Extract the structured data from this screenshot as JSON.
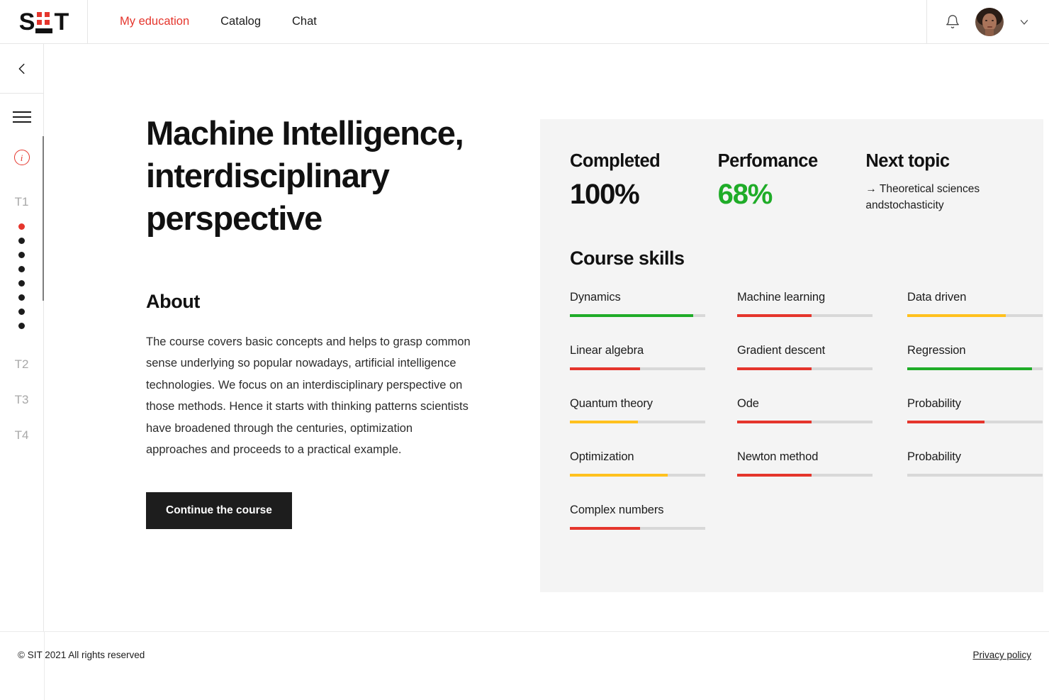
{
  "brand": {
    "logo_s": "S",
    "logo_t": "T",
    "logo_alt": "SIT"
  },
  "nav": {
    "links": [
      {
        "label": "My education",
        "active": true
      },
      {
        "label": "Catalog",
        "active": false
      },
      {
        "label": "Chat",
        "active": false
      }
    ],
    "bell_icon": "bell-icon",
    "avatar_icon": "user-avatar",
    "chevron_icon": "chevron-down-icon"
  },
  "sidebar": {
    "back_icon": "chevron-left-icon",
    "menu_icon": "hamburger-menu-icon",
    "info_icon": "info-icon",
    "info_glyph": "i",
    "topic_labels": [
      "T1",
      "T2",
      "T3",
      "T4"
    ],
    "lesson_dots": [
      {
        "current": true
      },
      {
        "current": false
      },
      {
        "current": false
      },
      {
        "current": false
      },
      {
        "current": false
      },
      {
        "current": false
      },
      {
        "current": false
      },
      {
        "current": false
      }
    ]
  },
  "course": {
    "title": "Machine Intelligence, interdisciplinary perspective",
    "about_heading": "About",
    "about_text": "The course covers basic concepts and helps to grasp common sense underlying so popular nowadays, artificial intelligence technologies. We focus on an interdisciplinary perspective on those methods. Hence it starts with thinking patterns scientists have broadened through the centuries, optimization approaches and proceeds to a practical example.",
    "cta_label": "Continue the course"
  },
  "stats": [
    {
      "label": "Completed",
      "value": "100%",
      "color": "#111111"
    },
    {
      "label": "Perfomance",
      "value": "68%",
      "color": "#1fac28"
    }
  ],
  "next_topic": {
    "label": "Next topic",
    "arrow": "→",
    "text": "Theoretical sciences andstochasticity"
  },
  "skills_section": {
    "heading": "Course skills"
  },
  "skills": [
    {
      "name": "Dynamics",
      "percent": 91,
      "color": "#1fac28"
    },
    {
      "name": "Machine learning",
      "percent": 55,
      "color": "#e5352c"
    },
    {
      "name": "Data driven",
      "percent": 73,
      "color": "#ffc11e"
    },
    {
      "name": "Linear algebra",
      "percent": 52,
      "color": "#e5352c"
    },
    {
      "name": "Gradient descent",
      "percent": 55,
      "color": "#e5352c"
    },
    {
      "name": "Regression",
      "percent": 92,
      "color": "#1fac28"
    },
    {
      "name": "Quantum theory",
      "percent": 50,
      "color": "#ffc11e"
    },
    {
      "name": "Ode",
      "percent": 55,
      "color": "#e5352c"
    },
    {
      "name": "Probability",
      "percent": 57,
      "color": "#e5352c"
    },
    {
      "name": "Optimization",
      "percent": 72,
      "color": "#ffc11e"
    },
    {
      "name": "Newton method",
      "percent": 55,
      "color": "#e5352c"
    },
    {
      "name": "Probability",
      "percent": 0,
      "color": "#e5352c"
    },
    {
      "name": "Complex numbers",
      "percent": 52,
      "color": "#e5352c"
    }
  ],
  "footer": {
    "copyright": "© SIT 2021 All rights reserved",
    "privacy": "Privacy policy"
  },
  "colors": {
    "accent_red": "#e5352c",
    "success_green": "#1fac28",
    "warn_yellow": "#ffc11e",
    "panel_bg": "#f4f4f4",
    "ink": "#111111"
  }
}
